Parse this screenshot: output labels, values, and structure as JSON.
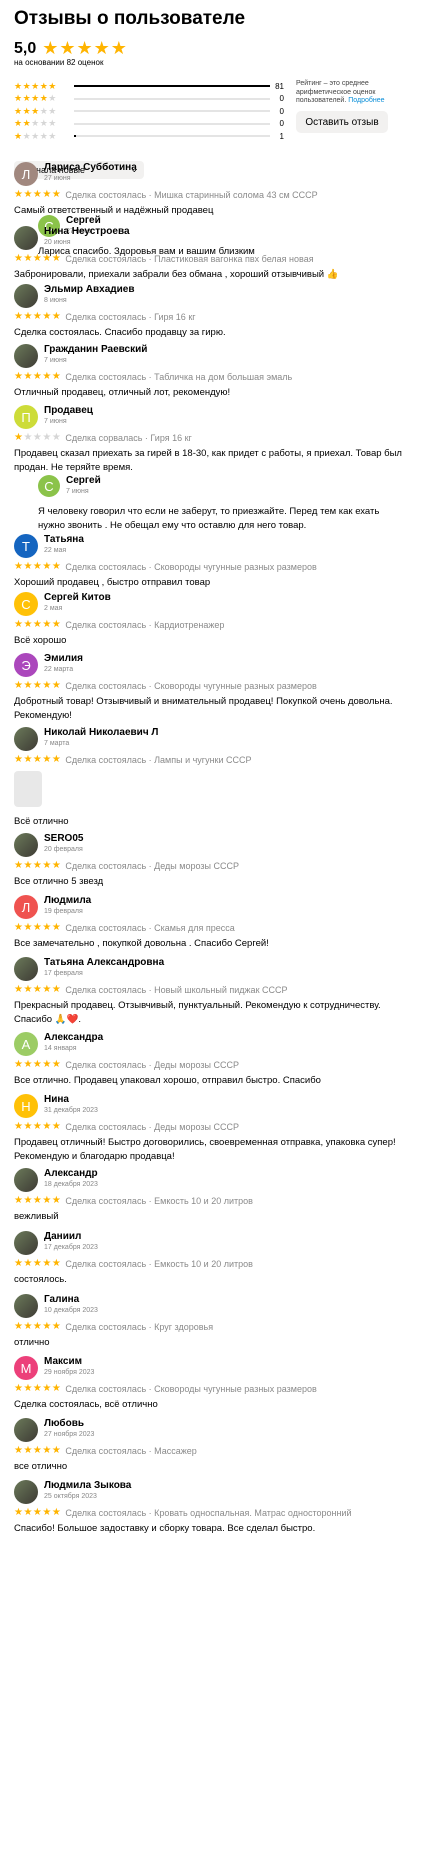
{
  "header": {
    "title": "Отзывы о пользователе",
    "average": "5,0",
    "stars": "★★★★★",
    "based_on": "на основании 82 оценок"
  },
  "distribution": [
    {
      "on": "★★★★★",
      "off": "",
      "fraction": 1.0,
      "count": "81"
    },
    {
      "on": "★★★★",
      "off": "★",
      "fraction": 0,
      "count": "0"
    },
    {
      "on": "★★★",
      "off": "★★",
      "fraction": 0,
      "count": "0"
    },
    {
      "on": "★★",
      "off": "★★★",
      "fraction": 0,
      "count": "0"
    },
    {
      "on": "★",
      "off": "★★★★",
      "fraction": 0.01,
      "count": "1"
    }
  ],
  "rating_note": {
    "text": "Рейтинг – это среднее арифметическое оценок пользователей.",
    "link": "Подробнее"
  },
  "leave_button": "Оставить отзыв",
  "sort": {
    "selected": "Сначала новые",
    "chevron_icon": "chevron-down-icon"
  },
  "colors": {
    "star": "#ffb400",
    "accent_link": "#0a8ed8"
  },
  "reviews": [
    {
      "initial": "Л",
      "color": "#a1887f",
      "name": "Лариса Субботина",
      "date": "27 июня",
      "stars_on": "★★★★★",
      "stars_off": "",
      "deal": "Сделка состоялась · Мишка старинный солома 43 см СССР",
      "text": "Самый ответственный и надёжный продавец",
      "reply": {
        "initial": "С",
        "color": "#8bc34a",
        "name": "Сергей",
        "date": "27 июня",
        "text": "Лариса спасибо. Здоровья вам и вашим близким"
      }
    },
    {
      "initial": "",
      "color": "",
      "name": "Нина Неустроева",
      "date": "20 июня",
      "stars_on": "★★★★★",
      "stars_off": "",
      "deal": "Сделка состоялась · Пластиковая вагонка пвх белая новая",
      "text": "Забронировали, приехали забрали без обмана , хороший отзывчивый 👍"
    },
    {
      "initial": "",
      "color": "",
      "name": "Эльмир Авхадиев",
      "date": "8 июня",
      "stars_on": "★★★★★",
      "stars_off": "",
      "deal": "Сделка состоялась · Гиря 16 кг",
      "text": "Сделка состоялась. Спасибо продавцу за гирю."
    },
    {
      "initial": "",
      "color": "",
      "name": "Гражданин Раевский",
      "date": "7 июня",
      "stars_on": "★★★★★",
      "stars_off": "",
      "deal": "Сделка состоялась · Табличка на дом большая эмаль",
      "text": "Отличный продавец, отличный лот, рекомендую!"
    },
    {
      "initial": "П",
      "color": "#cddc39",
      "name": "Продавец",
      "date": "7 июня",
      "stars_on": "★",
      "stars_off": "★★★★",
      "deal": "Сделка сорвалась · Гиря 16 кг",
      "text": "Продавец сказал приехать за гирей в 18-30, как придет с работы, я приехал. Товар был продан. Не теряйте время.",
      "reply": {
        "initial": "С",
        "color": "#8bc34a",
        "name": "Сергей",
        "date": "7 июня",
        "text": "Я человеку говорил что если не заберут, то приезжайте. Перед тем как ехать нужно звонить . Не обещал ему что оставлю для него товар."
      }
    },
    {
      "initial": "Т",
      "color": "#1565c0",
      "name": "Татьяна",
      "date": "22 мая",
      "stars_on": "★★★★★",
      "stars_off": "",
      "deal": "Сделка состоялась · Сковороды чугунные разных размеров",
      "text": "Хороший продавец , быстро отправил товар"
    },
    {
      "initial": "С",
      "color": "#ffc107",
      "name": "Сергей Китов",
      "date": "2 мая",
      "stars_on": "★★★★★",
      "stars_off": "",
      "deal": "Сделка состоялась · Кардиотренажер",
      "text": "Всё хорошо"
    },
    {
      "initial": "Э",
      "color": "#ab47bc",
      "name": "Эмилия",
      "date": "22 марта",
      "stars_on": "★★★★★",
      "stars_off": "",
      "deal": "Сделка состоялась · Сковороды чугунные разных размеров",
      "text": "Добротный товар! Отзывчивый и внимательный продавец! Покупкой очень довольна. Рекомендую!"
    },
    {
      "initial": "",
      "color": "",
      "name": "Николай Николаевич Л",
      "date": "7 марта",
      "stars_on": "★★★★★",
      "stars_off": "",
      "deal": "Сделка состоялась · Лампы и чугунки СССР",
      "text": "Всё отлично",
      "thumb": true
    },
    {
      "initial": "",
      "color": "",
      "name": "SERO05",
      "date": "20 февраля",
      "stars_on": "★★★★★",
      "stars_off": "",
      "deal": "Сделка состоялась · Деды морозы СССР",
      "text": "Все отлично 5 звезд"
    },
    {
      "initial": "Л",
      "color": "#ef5350",
      "name": "Людмила",
      "date": "19 февраля",
      "stars_on": "★★★★★",
      "stars_off": "",
      "deal": "Сделка состоялась · Скамья для пресса",
      "text": "Все замечательно , покупкой довольна . Спасибо Сергей!"
    },
    {
      "initial": "",
      "color": "",
      "name": "Татьяна Александровна",
      "date": "17 февраля",
      "stars_on": "★★★★★",
      "stars_off": "",
      "deal": "Сделка состоялась · Новый школьный пиджак СССР",
      "text": "Прекрасный продавец. Отзывчивый, пунктуальный. Рекомендую к сотрудничеству. Спасибо 🙏❤️."
    },
    {
      "initial": "А",
      "color": "#9ccc65",
      "name": "Александра",
      "date": "14 января",
      "stars_on": "★★★★★",
      "stars_off": "",
      "deal": "Сделка состоялась · Деды морозы СССР",
      "text": "Все отлично. Продавец упаковал хорошо, отправил быстро. Спасибо"
    },
    {
      "initial": "Н",
      "color": "#ffc107",
      "name": "Нина",
      "date": "31 декабря 2023",
      "stars_on": "★★★★★",
      "stars_off": "",
      "deal": "Сделка состоялась · Деды морозы СССР",
      "text": "Продавец отличный! Быстро договорились, своевременная отправка, упаковка супер! Рекомендую и благодарю продавца!"
    },
    {
      "initial": "",
      "color": "",
      "name": "Александр",
      "date": "18 декабря 2023",
      "stars_on": "★★★★★",
      "stars_off": "",
      "deal": "Сделка состоялась · Емкость 10 и 20 литров",
      "text": "вежливый"
    },
    {
      "initial": "",
      "color": "",
      "name": "Даниил",
      "date": "17 декабря 2023",
      "stars_on": "★★★★★",
      "stars_off": "",
      "deal": "Сделка состоялась · Емкость 10 и 20 литров",
      "text": "состоялось."
    },
    {
      "initial": "",
      "color": "",
      "name": "Галина",
      "date": "10 декабря 2023",
      "stars_on": "★★★★★",
      "stars_off": "",
      "deal": "Сделка состоялась · Круг здоровья",
      "text": "отлично"
    },
    {
      "initial": "М",
      "color": "#ec407a",
      "name": "Максим",
      "date": "29 ноября 2023",
      "stars_on": "★★★★★",
      "stars_off": "",
      "deal": "Сделка состоялась · Сковороды чугунные разных размеров",
      "text": "Сделка состоялась, всё отлично"
    },
    {
      "initial": "",
      "color": "",
      "name": "Любовь",
      "date": "27 ноября 2023",
      "stars_on": "★★★★★",
      "stars_off": "",
      "deal": "Сделка состоялась · Массажер",
      "text": "все отлично"
    },
    {
      "initial": "",
      "color": "",
      "name": "Людмила Зыкова",
      "date": "25 октября 2023",
      "stars_on": "★★★★★",
      "stars_off": "",
      "deal": "Сделка состоялась · Кровать односпальная. Матрас односторонний",
      "text": "Спасибо! Большое задоставку и сборку товара. Все сделал быстро."
    }
  ]
}
